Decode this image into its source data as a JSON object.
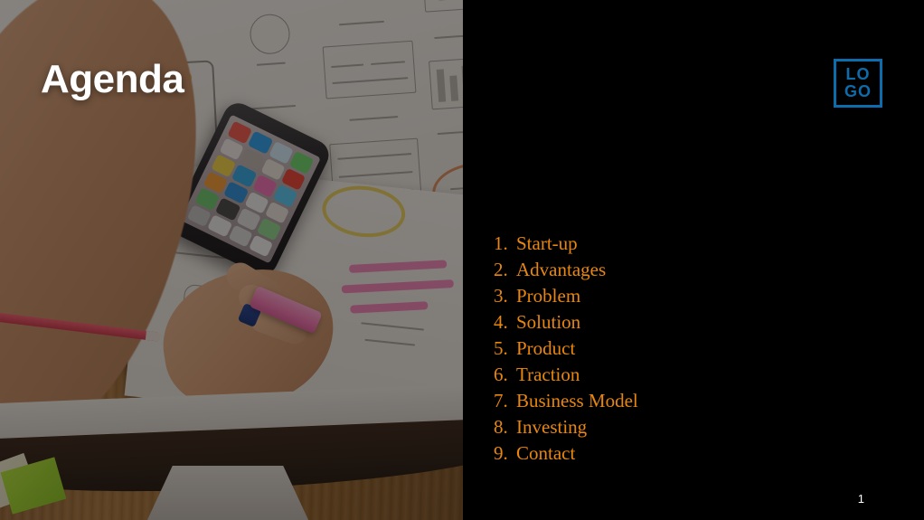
{
  "slide": {
    "title": "Agenda",
    "page_number": "1",
    "background_color": "#000000",
    "accent_color": "#e8860e",
    "logo_color": "#0d6cab",
    "title_color": "#ffffff"
  },
  "logo": {
    "line1": "LO",
    "line2": "GO",
    "alt": "LOGO"
  },
  "agenda": {
    "items": [
      {
        "number": "1.",
        "label": "Start-up"
      },
      {
        "number": "2.",
        "label": "Advantages"
      },
      {
        "number": "3.",
        "label": "Problem"
      },
      {
        "number": "4.",
        "label": "Solution"
      },
      {
        "number": "5.",
        "label": "Product"
      },
      {
        "number": "6.",
        "label": "Traction"
      },
      {
        "number": "7.",
        "label": "Business Model"
      },
      {
        "number": "8.",
        "label": "Investing"
      },
      {
        "number": "9.",
        "label": "Contact"
      }
    ]
  },
  "photo": {
    "description": "Overhead photo of a desk: a hand holding a pink highlighter marker over white paper covered in hand-drawn app wireframe sketches, a smartphone showing a home screen, a red pencil, green sticky notes and a wooden desktop."
  }
}
